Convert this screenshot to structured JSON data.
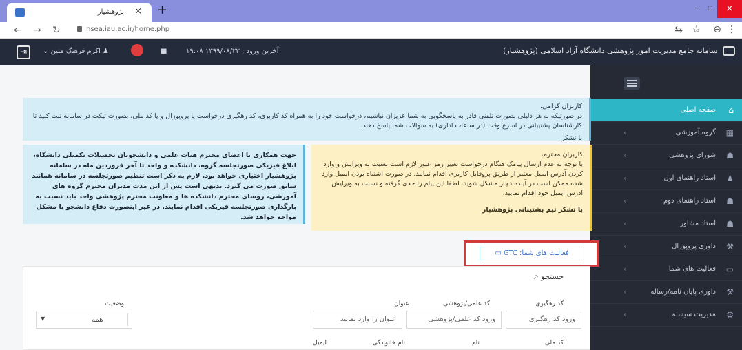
{
  "browser": {
    "tab_title": "پژوهشیار",
    "url": "nsea.iau.ac.ir/home.php",
    "close_icon": "×",
    "new_tab_icon": "+",
    "window_close_icon": "×"
  },
  "header": {
    "brand": "سامانه جامع مدیریت امور پژوهشی دانشگاه آزاد اسلامی (پژوهشیار)",
    "last_login": "آخرین ورود : ۱۳۹۹/۰۸/۲۳ ۱۹:۰۸",
    "user_name": "اکرم فرهنگ متین"
  },
  "sidebar": {
    "items": [
      {
        "label": "صفحه اصلی",
        "icon": "home-icon"
      },
      {
        "label": "گروه آموزشی",
        "icon": "table-icon"
      },
      {
        "label": "شورای پژوهشی",
        "icon": "users-icon"
      },
      {
        "label": "استاد راهنمای اول",
        "icon": "user-icon"
      },
      {
        "label": "استاد راهنمای دوم",
        "icon": "users-icon"
      },
      {
        "label": "استاد مشاور",
        "icon": "users-icon"
      },
      {
        "label": "داوری پروپوزال",
        "icon": "gavel-icon"
      },
      {
        "label": "فعالیت های شما",
        "icon": "list-icon"
      },
      {
        "label": "داوری پایان نامه/رساله",
        "icon": "gavel-icon"
      },
      {
        "label": "مدیریت سیستم",
        "icon": "gears-icon"
      }
    ]
  },
  "alerts": {
    "top_title": "کاربران گرامی،",
    "top_body": "در صورتیکه به هر دلیلی بصورت تلفنی قادر به پاسخگویی به شما عزیزان نباشیم، درخواست خود را به همراه کد کاربری، کد رهگیری درخواست یا پروپوزال و یا کد ملی، بصورت تیکت در سامانه ثبت کنید تا کارشناسان پشتیبانی در اسرع وقت (در ساعات اداری) به سوالات شما پاسخ دهند.",
    "top_signoff": "با تشکر",
    "yellow_title": "کاربران محترم،",
    "yellow_body": "با توجه به عدم ارسال پیامک هنگام درخواست تغییر رمز عبور لازم است نسبت به ویرایش و وارد کردن آدرس ایمیل معتبر از طریق پروفایل کاربری اقدام نمایند. در صورت اشتباه بودن ایمیل وارد شده ممکن است در آینده دچار مشکل شوید. لطفا این پیام را جدی گرفته و نسبت به ویرایش آدرس ایمیل خود اقدام نمایید.",
    "yellow_signoff": "با تشکر   تیم پشتیبانی پژوهشیار",
    "blue_body": "جهت همکاری با اعضای محترم هیات علمی و دانشجویان تحصیلات تکمیلی دانشگاه، ابلاغ فیزیکی صورتجلسه گروه، دانشکده و واحد تا آخر فروردین ماه در سامانه پژوهشیار اختیاری خواهد بود. لازم به ذکر است تنظیم صورتجلسه در سامانه همانند سابق صورت می گیرد. بدیهی است پس از این مدت مدیران محترم گروه های آموزشی، روسای محترم دانشکده ها و معاونت محترم پژوهشی واحد باید نسبت به بارگذاری صورتجلسه فیزیکی اقدام نمایند. در غیر اینصورت دفاع دانشجو با مشکل مواجه خواهد شد."
  },
  "activity_button": "فعالیت های شما: GTC",
  "search": {
    "title": "جستجو",
    "labels": {
      "tracking": "کد رهگیری",
      "researcher": "کد علمی/پژوهشی",
      "title": "عنوان",
      "status": "وضعیت"
    },
    "placeholders": {
      "tracking": "ورود کد رهگیری",
      "researcher": "ورود کد علمی/پژوهشی",
      "title": "عنوان را وارد نمایید"
    },
    "status_value": "همه"
  },
  "table": {
    "headers": [
      "کد ملی",
      "نام",
      "نام خانوادگی",
      "ایمیل"
    ]
  },
  "colors": {
    "accent": "#2db6c6",
    "sidebar_bg": "#252a35",
    "header_bg": "#242b3a",
    "highlight_border": "#d13b3b"
  }
}
